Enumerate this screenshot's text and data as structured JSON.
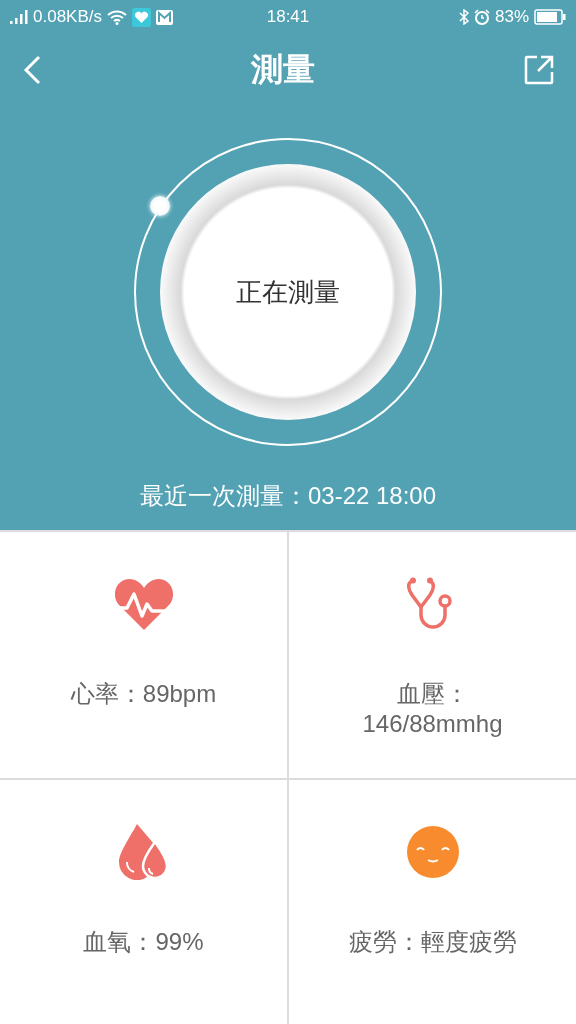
{
  "status_bar": {
    "network_speed": "0.08KB/s",
    "time": "18:41",
    "battery": "83%"
  },
  "header": {
    "title": "測量"
  },
  "dial": {
    "label": "正在測量"
  },
  "last_measurement": "最近一次測量：03-22 18:00",
  "metrics": [
    {
      "kind": "heart",
      "text": "心率：89bpm"
    },
    {
      "kind": "stethoscope",
      "text": "血壓：146/88mmhg"
    },
    {
      "kind": "drops",
      "text": "血氧：99%"
    },
    {
      "kind": "face",
      "text": "疲勞：輕度疲勞"
    }
  ]
}
